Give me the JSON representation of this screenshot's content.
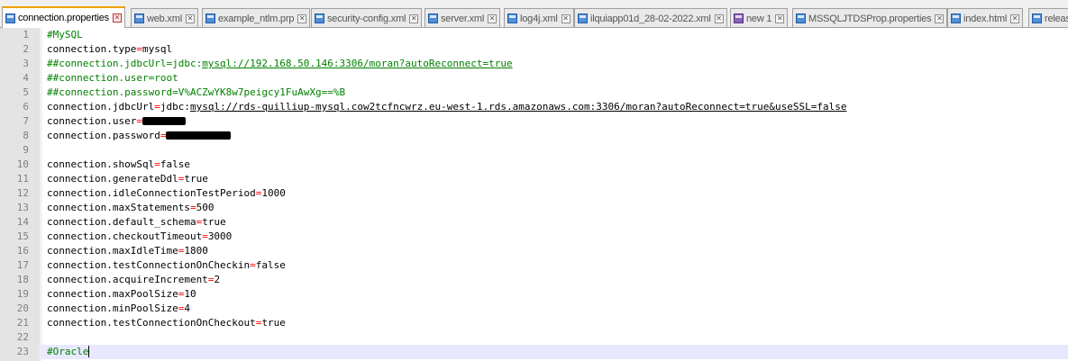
{
  "tabs": [
    {
      "label": "connection.properties",
      "active": true,
      "icon": "file-save-icon"
    },
    {
      "label": "web.xml",
      "icon": "file-save-icon"
    },
    {
      "label": "example_ntlm.prp",
      "icon": "file-save-icon"
    },
    {
      "label": "security-config.xml",
      "icon": "file-save-icon"
    },
    {
      "label": "server.xml",
      "icon": "file-save-icon"
    },
    {
      "label": "log4j.xml",
      "icon": "file-save-icon"
    },
    {
      "label": "ilquiapp01d_28-02-2022.xml",
      "icon": "file-save-icon"
    },
    {
      "label": "new 1",
      "icon": "file-unsaved-icon"
    },
    {
      "label": "MSSQLJTDSProp.properties",
      "icon": "file-save-icon"
    },
    {
      "label": "index.html",
      "icon": "file-save-icon"
    },
    {
      "label": "releas",
      "icon": "file-save-icon"
    }
  ],
  "lines": [
    {
      "num": "1",
      "text": "#MySQL"
    },
    {
      "num": "2",
      "key": "connection.type",
      "value": "mysql"
    },
    {
      "num": "3",
      "text": "##connection.jdbcUrl=jdbc:",
      "url": "mysql://192.168.50.146:3306/moran?autoReconnect=true"
    },
    {
      "num": "4",
      "text": "##connection.user=root"
    },
    {
      "num": "5",
      "text": "##connection.password=V%ACZwYK8w7peigcy1FuAwXg==%B"
    },
    {
      "num": "6",
      "key": "connection.jdbcUrl",
      "value": "jdbc:",
      "url": "mysql://rds-quilliup-mysql.cow2tcfncwrz.eu-west-1.rds.amazonaws.com:3306/moran?autoReconnect=true&useSSL=false"
    },
    {
      "num": "7",
      "key": "connection.user",
      "redacted": true
    },
    {
      "num": "8",
      "key": "connection.password",
      "redacted": true
    },
    {
      "num": "9"
    },
    {
      "num": "10",
      "key": "connection.showSql",
      "value": "false"
    },
    {
      "num": "11",
      "key": "connection.generateDdl",
      "value": "true"
    },
    {
      "num": "12",
      "key": "connection.idleConnectionTestPeriod",
      "value": "1000"
    },
    {
      "num": "13",
      "key": "connection.maxStatements",
      "value": "500"
    },
    {
      "num": "14",
      "key": "connection.default_schema",
      "value": "true"
    },
    {
      "num": "15",
      "key": "connection.checkoutTimeout",
      "value": "3000"
    },
    {
      "num": "16",
      "key": "connection.maxIdleTime",
      "value": "1800"
    },
    {
      "num": "17",
      "key": "connection.testConnectionOnCheckin",
      "value": "false"
    },
    {
      "num": "18",
      "key": "connection.acquireIncrement",
      "value": "2"
    },
    {
      "num": "19",
      "key": "connection.maxPoolSize",
      "value": "10"
    },
    {
      "num": "20",
      "key": "connection.minPoolSize",
      "value": "4"
    },
    {
      "num": "21",
      "key": "connection.testConnectionOnCheckout",
      "value": "true"
    },
    {
      "num": "22"
    },
    {
      "num": "23",
      "text": "#Oracle",
      "current": true
    }
  ],
  "colors": {
    "comment": "#008000",
    "operator": "#ff0000",
    "active_tab_accent": "#f0a000",
    "current_line": "#e8e8ff"
  }
}
